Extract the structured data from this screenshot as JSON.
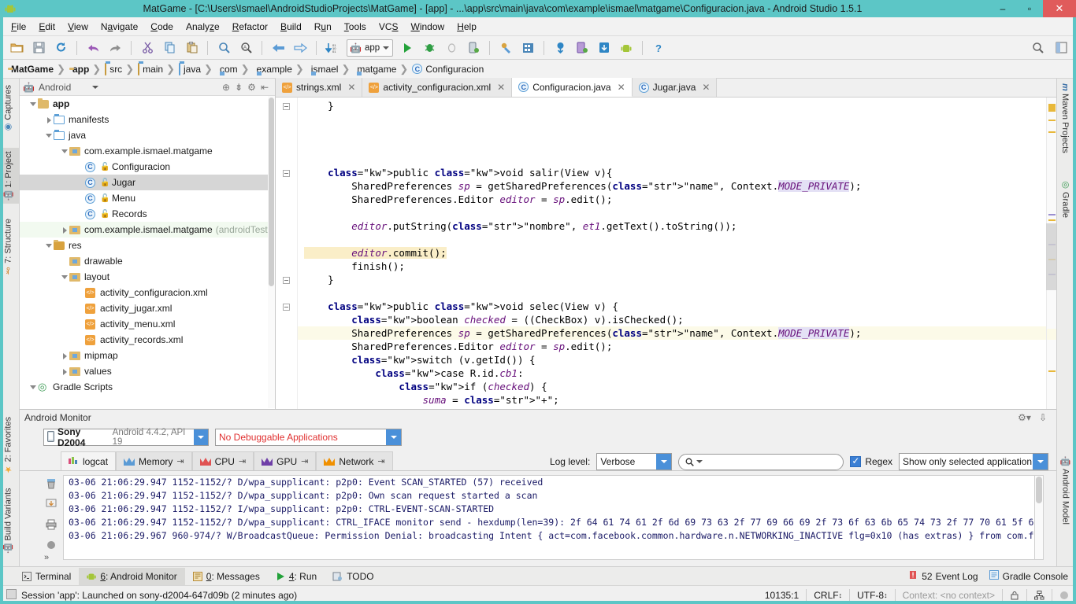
{
  "window": {
    "title": "MatGame - [C:\\Users\\Ismael\\AndroidStudioProjects\\MatGame] - [app] - ...\\app\\src\\main\\java\\com\\example\\ismael\\matgame\\Configuracion.java - Android Studio 1.5.1",
    "minimize": "–",
    "maximize": "▫",
    "close": "✕",
    "accent_color": "#5cc6c6"
  },
  "menubar": {
    "items": [
      "File",
      "Edit",
      "View",
      "Navigate",
      "Code",
      "Analyze",
      "Refactor",
      "Build",
      "Run",
      "Tools",
      "VCS",
      "Window",
      "Help"
    ]
  },
  "toolbar": {
    "run_config": "app",
    "icons": [
      "open-folder-icon",
      "save-all-icon",
      "sync-icon",
      "undo-icon",
      "redo-icon",
      "cut-icon",
      "copy-icon",
      "paste-icon",
      "find-icon",
      "replace-icon",
      "back-icon",
      "forward-icon",
      "compile-icon",
      "run-icon",
      "debug-icon",
      "coverage-icon",
      "instant-run-icon",
      "sdk-manager-icon",
      "avd-manager-icon",
      "sync-gradle-icon",
      "avd-icon",
      "layout-inspector-icon",
      "android-device-monitor-icon",
      "help-icon",
      "search-everywhere-icon",
      "layout-settings-icon"
    ]
  },
  "breadcrumb": {
    "items": [
      {
        "label": "MatGame",
        "icon": "module-icon",
        "bold": true
      },
      {
        "label": "app",
        "icon": "module-icon",
        "bold": true
      },
      {
        "label": "src",
        "icon": "folder-icon",
        "bold": false
      },
      {
        "label": "main",
        "icon": "folder-icon",
        "bold": false
      },
      {
        "label": "java",
        "icon": "source-folder-icon",
        "bold": false
      },
      {
        "label": "com",
        "icon": "package-icon",
        "bold": false
      },
      {
        "label": "example",
        "icon": "package-icon",
        "bold": false
      },
      {
        "label": "ismael",
        "icon": "package-icon",
        "bold": false
      },
      {
        "label": "matgame",
        "icon": "package-icon",
        "bold": false
      },
      {
        "label": "Configuracion",
        "icon": "class-icon",
        "bold": false
      }
    ],
    "separator": "❯"
  },
  "left_strip": {
    "top": [
      {
        "label": "Captures",
        "icon": "captures-icon",
        "selected": false
      },
      {
        "label": "1: Project",
        "icon": "project-icon",
        "selected": true
      },
      {
        "label": "7: Structure",
        "icon": "structure-icon",
        "selected": false
      }
    ],
    "bottom": [
      {
        "label": "2: Favorites",
        "icon": "favorites-star-icon",
        "selected": false
      },
      {
        "label": "Build Variants",
        "icon": "build-variants-icon",
        "selected": false
      }
    ]
  },
  "right_strip": {
    "top": [
      {
        "label": "Maven Projects",
        "icon": "maven-icon"
      },
      {
        "label": "Gradle",
        "icon": "gradle-icon"
      }
    ],
    "bottom": [
      {
        "label": "Android Model",
        "icon": "android-icon"
      }
    ]
  },
  "project_panel": {
    "selector": "Android",
    "actions": [
      "target-icon",
      "collapse-all-icon",
      "settings-gear-icon",
      "hide-panel-icon"
    ],
    "tree": [
      {
        "depth": 0,
        "arrow": "open",
        "icon": "module-icon",
        "label": "app",
        "bold": true,
        "selected": false
      },
      {
        "depth": 1,
        "arrow": "closed",
        "icon": "folder-blue-icon",
        "label": "manifests",
        "bold": false,
        "selected": false
      },
      {
        "depth": 1,
        "arrow": "open",
        "icon": "folder-blue-icon",
        "label": "java",
        "bold": false,
        "selected": false
      },
      {
        "depth": 2,
        "arrow": "open",
        "icon": "package-icon",
        "label": "com.example.ismael.matgame",
        "bold": false,
        "selected": false
      },
      {
        "depth": 3,
        "arrow": "none",
        "icon": "class-icon",
        "label": "Configuracion",
        "bold": false,
        "selected": false,
        "lock": true
      },
      {
        "depth": 3,
        "arrow": "none",
        "icon": "class-icon",
        "label": "Jugar",
        "bold": false,
        "selected": true,
        "lock": true
      },
      {
        "depth": 3,
        "arrow": "none",
        "icon": "class-icon",
        "label": "Menu",
        "bold": false,
        "selected": false,
        "lock": true
      },
      {
        "depth": 3,
        "arrow": "none",
        "icon": "class-icon",
        "label": "Records",
        "bold": false,
        "selected": false,
        "lock": true
      },
      {
        "depth": 2,
        "arrow": "closed",
        "icon": "package-icon",
        "label": "com.example.ismael.matgame",
        "sublabel": "(androidTest)",
        "bold": false,
        "selected": false,
        "testsrc": true
      },
      {
        "depth": 1,
        "arrow": "open",
        "icon": "res-folder-icon",
        "label": "res",
        "bold": false,
        "selected": false
      },
      {
        "depth": 2,
        "arrow": "none",
        "icon": "package-icon",
        "label": "drawable",
        "bold": false,
        "selected": false
      },
      {
        "depth": 2,
        "arrow": "open",
        "icon": "package-icon",
        "label": "layout",
        "bold": false,
        "selected": false
      },
      {
        "depth": 3,
        "arrow": "none",
        "icon": "xml-layout-icon",
        "label": "activity_configuracion.xml",
        "bold": false,
        "selected": false
      },
      {
        "depth": 3,
        "arrow": "none",
        "icon": "xml-layout-icon",
        "label": "activity_jugar.xml",
        "bold": false,
        "selected": false
      },
      {
        "depth": 3,
        "arrow": "none",
        "icon": "xml-layout-icon",
        "label": "activity_menu.xml",
        "bold": false,
        "selected": false
      },
      {
        "depth": 3,
        "arrow": "none",
        "icon": "xml-layout-icon",
        "label": "activity_records.xml",
        "bold": false,
        "selected": false
      },
      {
        "depth": 2,
        "arrow": "closed",
        "icon": "package-icon",
        "label": "mipmap",
        "bold": false,
        "selected": false
      },
      {
        "depth": 2,
        "arrow": "closed",
        "icon": "package-icon",
        "label": "values",
        "bold": false,
        "selected": false
      },
      {
        "depth": 0,
        "arrow": "open",
        "icon": "gradle-icon",
        "label": "Gradle Scripts",
        "bold": false,
        "selected": false
      }
    ]
  },
  "editor": {
    "tabs": [
      {
        "label": "strings.xml",
        "icon": "xml-layout-icon",
        "active": false,
        "close": "✕"
      },
      {
        "label": "activity_configuracion.xml",
        "icon": "xml-layout-icon",
        "active": false,
        "close": "✕"
      },
      {
        "label": "Configuracion.java",
        "icon": "class-icon",
        "active": true,
        "close": "✕"
      },
      {
        "label": "Jugar.java",
        "icon": "class-icon",
        "active": false,
        "close": "✕"
      }
    ],
    "code_lines": [
      "    }",
      "",
      "",
      "",
      "",
      "    public void salir(View v){",
      "        SharedPreferences sp = getSharedPreferences(\"name\", Context.MODE_PRIVATE);",
      "        SharedPreferences.Editor editor = sp.edit();",
      "",
      "        editor.putString(\"nombre\", et1.getText().toString());",
      "",
      "        editor.commit();",
      "        finish();",
      "    }",
      "",
      "    public void selec(View v) {",
      "        boolean checked = ((CheckBox) v).isChecked();",
      "        SharedPreferences sp = getSharedPreferences(\"name\", Context.MODE_PRIVATE);",
      "        SharedPreferences.Editor editor = sp.edit();",
      "        switch (v.getId()) {",
      "            case R.id.cb1:",
      "                if (checked) {",
      "                    suma = \"+\";"
    ]
  },
  "monitor": {
    "title": "Android Monitor",
    "device": "Sony D2004",
    "device_detail": "Android 4.4.2, API 19",
    "debuggable": "No Debuggable Applications",
    "tabs": [
      {
        "label": "logcat",
        "icon": "logcat-icon",
        "active": true,
        "detach": ""
      },
      {
        "label": "Memory",
        "icon": "memory-icon",
        "active": false,
        "detach": "⇥"
      },
      {
        "label": "CPU",
        "icon": "cpu-icon",
        "active": false,
        "detach": "⇥"
      },
      {
        "label": "GPU",
        "icon": "gpu-icon",
        "active": false,
        "detach": "⇥"
      },
      {
        "label": "Network",
        "icon": "network-icon",
        "active": false,
        "detach": "⇥"
      }
    ],
    "log_level_label": "Log level:",
    "log_level_value": "Verbose",
    "search_placeholder": "",
    "regex_label": "Regex",
    "regex_checked": true,
    "filter_value": "Show only selected application",
    "log_lines": [
      "03-06 21:06:29.947 1152-1152/? D/wpa_supplicant: p2p0: Event SCAN_STARTED (57) received",
      "03-06 21:06:29.947 1152-1152/? D/wpa_supplicant: p2p0: Own scan request started a scan",
      "03-06 21:06:29.947 1152-1152/? I/wpa_supplicant: p2p0: CTRL-EVENT-SCAN-STARTED",
      "03-06 21:06:29.947 1152-1152/? D/wpa_supplicant: CTRL_IFACE monitor send - hexdump(len=39): 2f 64 61 74 61 2f 6d 69 73 63 2f 77 69 66 69 2f 73 6f 63 6b 65 74 73 2f 77 70 61 5f 6",
      "03-06 21:06:29.967 960-974/? W/BroadcastQueue: Permission Denial: broadcasting Intent { act=com.facebook.common.hardware.n.NETWORKING_INACTIVE flg=0x10 (has extras) } from com.f"
    ],
    "side_icons": [
      "clear-logcat-icon",
      "scroll-to-end-icon",
      "print-icon",
      "restart-icon"
    ],
    "expand_glyph": "»"
  },
  "bottom_bar": {
    "tabs": [
      {
        "label": "Terminal",
        "icon": "terminal-icon",
        "active": false
      },
      {
        "label": "6: Android Monitor",
        "icon": "android-icon",
        "active": true
      },
      {
        "label": "0: Messages",
        "icon": "messages-icon",
        "active": false
      },
      {
        "label": "4: Run",
        "icon": "run-icon",
        "active": false
      },
      {
        "label": "TODO",
        "icon": "todo-icon",
        "active": false
      }
    ],
    "right": [
      {
        "label": "52",
        "icon": "event-log-icon",
        "text": "Event Log"
      },
      {
        "label": "",
        "icon": "gradle-console-icon",
        "text": "Gradle Console"
      }
    ]
  },
  "statusbar": {
    "message": "Session 'app': Launched on sony-d2004-647d09b (2 minutes ago)",
    "position": "10135:1",
    "line_sep": "CRLF",
    "encoding": "UTF-8",
    "context": "Context: <no context>",
    "icons": [
      "lock-icon",
      "hierarchy-icon",
      "background-tasks-icon"
    ]
  }
}
